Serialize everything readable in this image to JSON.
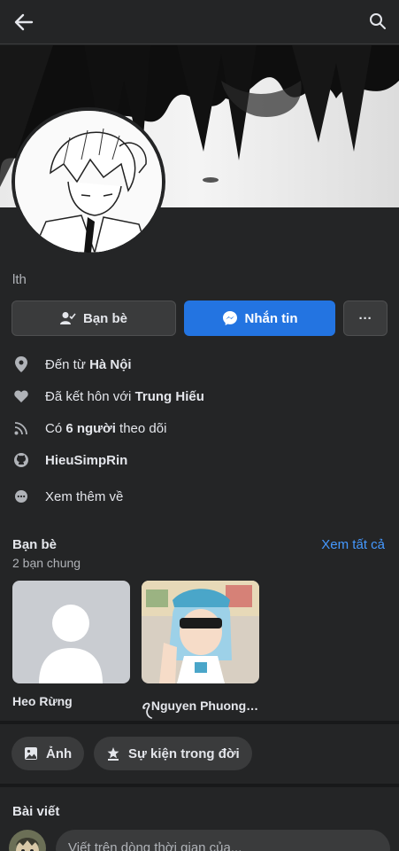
{
  "header": {
    "back_icon": "arrow-left-icon",
    "search_icon": "search-icon"
  },
  "profile": {
    "username": "lth"
  },
  "actions": {
    "friends_label": "Bạn bè",
    "message_label": "Nhắn tin",
    "more_label": "···",
    "message_color": "#2374e1"
  },
  "info": {
    "from_prefix": "Đến từ ",
    "from_value": "Hà Nội",
    "married_prefix": "Đã kết hôn với ",
    "married_value": "Trung Hiếu",
    "followers_prefix": "Có ",
    "followers_value": "6 người",
    "followers_suffix": " theo dõi",
    "github": "HieuSimpRin",
    "see_more": "Xem thêm về"
  },
  "friends": {
    "title": "Bạn bè",
    "subtitle": "2 bạn chung",
    "see_all": "Xem tất cả",
    "link_color": "#4599ff",
    "items": [
      {
        "name": "Heo Rừng"
      },
      {
        "name": "ꪖNguyen Phuong ..."
      }
    ]
  },
  "chips": {
    "photos": "Ảnh",
    "life_events": "Sự kiện trong đời"
  },
  "posts": {
    "title": "Bài viết",
    "placeholder": "Viết trên dòng thời gian của..."
  }
}
